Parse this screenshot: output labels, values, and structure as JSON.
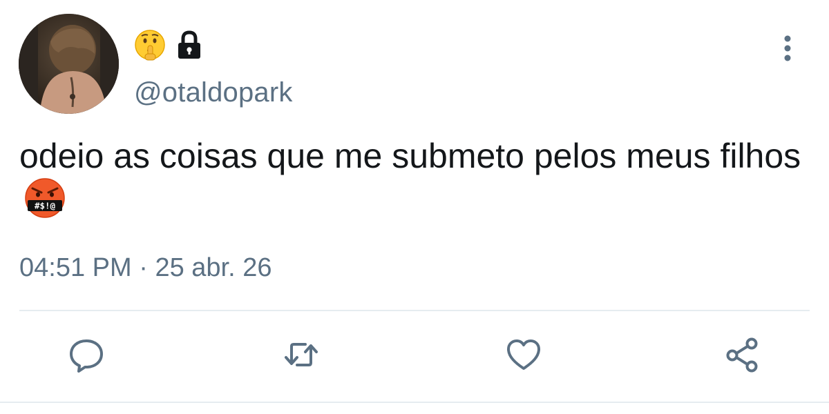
{
  "user": {
    "display_emojis": [
      "shushing-face",
      "lock"
    ],
    "handle": "@otaldopark"
  },
  "tweet": {
    "text": "odeio as coisas que me submeto pelos meus filhos",
    "trailing_emoji": "face-with-symbols-on-mouth",
    "emoji_symbols": "#$!@",
    "time": "04:51 PM",
    "separator": "·",
    "date": "25 abr. 26"
  },
  "actions": {
    "reply_icon": "reply-icon",
    "retweet_icon": "retweet-icon",
    "like_icon": "heart-icon",
    "share_icon": "share-icon"
  },
  "colors": {
    "text_primary": "#14171a",
    "text_secondary": "#5b7083",
    "icon": "#5b7083",
    "divider": "#e6ecf0"
  }
}
